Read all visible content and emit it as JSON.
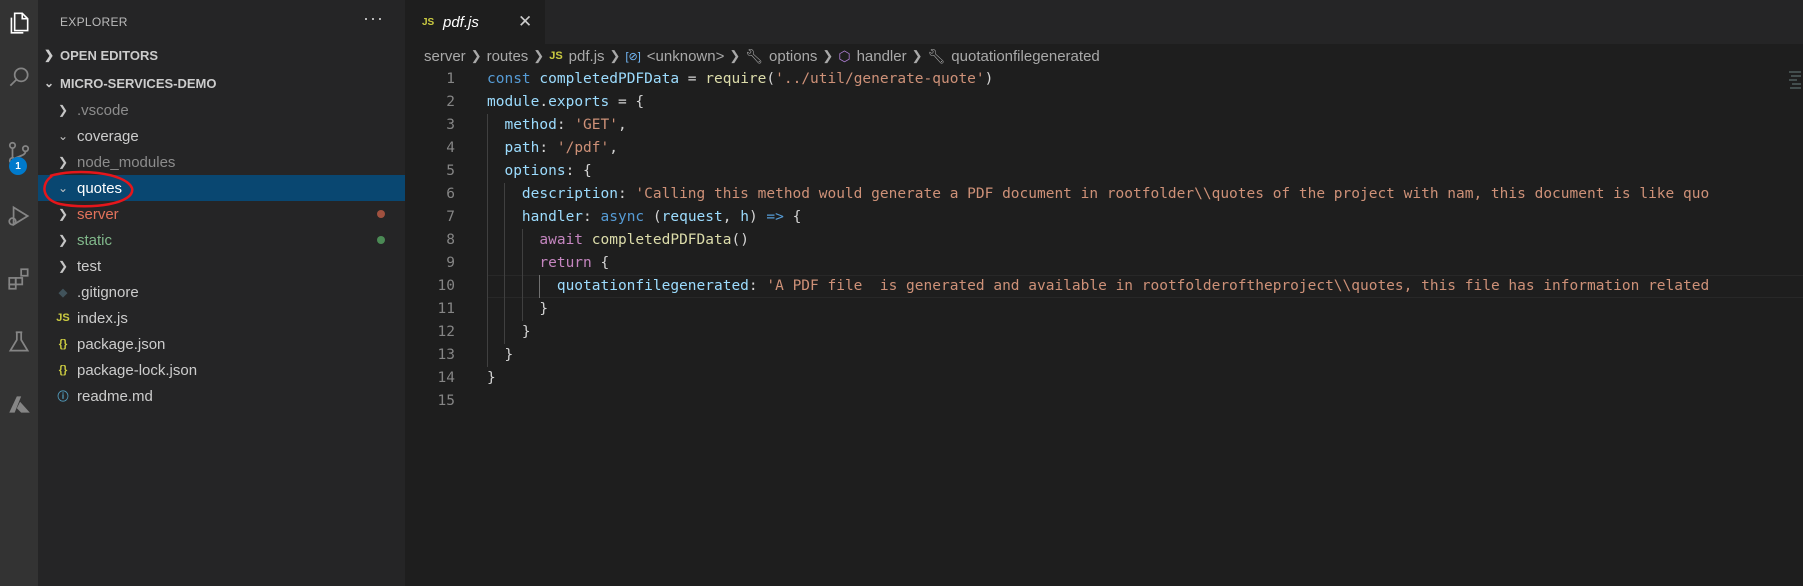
{
  "sidebar": {
    "title": "EXPLORER",
    "more": "···",
    "open_editors": "OPEN EDITORS",
    "project": "MICRO-SERVICES-DEMO",
    "items": [
      {
        "label": ".vscode",
        "kind": "folder",
        "expanded": false,
        "state": "ignored"
      },
      {
        "label": "coverage",
        "kind": "folder",
        "expanded": true,
        "state": "normal"
      },
      {
        "label": "node_modules",
        "kind": "folder",
        "expanded": false,
        "state": "ignored"
      },
      {
        "label": "quotes",
        "kind": "folder",
        "expanded": true,
        "state": "selected"
      },
      {
        "label": "server",
        "kind": "folder",
        "expanded": false,
        "state": "modified"
      },
      {
        "label": "static",
        "kind": "folder",
        "expanded": false,
        "state": "added"
      },
      {
        "label": "test",
        "kind": "folder",
        "expanded": false,
        "state": "normal"
      },
      {
        "label": ".gitignore",
        "kind": "file",
        "icon": "◆",
        "state": "normal"
      },
      {
        "label": "index.js",
        "kind": "file",
        "icon": "JS",
        "state": "normal"
      },
      {
        "label": "package.json",
        "kind": "file",
        "icon": "{}",
        "state": "normal"
      },
      {
        "label": "package-lock.json",
        "kind": "file",
        "icon": "{}",
        "state": "normal"
      },
      {
        "label": "readme.md",
        "kind": "file",
        "icon": "ⓘ",
        "state": "normal"
      }
    ]
  },
  "activity": {
    "source_control_badge": "1"
  },
  "tab": {
    "icon": "JS",
    "name": "pdf.js",
    "close": "✕"
  },
  "breadcrumb": {
    "items": [
      "server",
      "routes",
      "pdf.js",
      "<unknown>",
      "options",
      "handler",
      "quotationfilegenerated"
    ]
  },
  "editor": {
    "line_numbers": [
      "1",
      "2",
      "3",
      "4",
      "5",
      "6",
      "7",
      "8",
      "9",
      "10",
      "11",
      "12",
      "13",
      "14",
      "15"
    ],
    "lines": [
      [
        [
          "kw",
          "const"
        ],
        [
          "p",
          " "
        ],
        [
          "var",
          "completedPDFData"
        ],
        [
          "p",
          " = "
        ],
        [
          "fn",
          "require"
        ],
        [
          "p",
          "("
        ],
        [
          "str",
          "'../util/generate-quote'"
        ],
        [
          "p",
          ")"
        ]
      ],
      [
        [
          "var",
          "module"
        ],
        [
          "p",
          "."
        ],
        [
          "var",
          "exports"
        ],
        [
          "p",
          " = {"
        ]
      ],
      [
        [
          "p",
          "  "
        ],
        [
          "var",
          "method"
        ],
        [
          "p",
          ": "
        ],
        [
          "str",
          "'GET'"
        ],
        [
          "p",
          ","
        ]
      ],
      [
        [
          "p",
          "  "
        ],
        [
          "var",
          "path"
        ],
        [
          "p",
          ": "
        ],
        [
          "str",
          "'/pdf'"
        ],
        [
          "p",
          ","
        ]
      ],
      [
        [
          "p",
          "  "
        ],
        [
          "var",
          "options"
        ],
        [
          "p",
          ": {"
        ]
      ],
      [
        [
          "p",
          "    "
        ],
        [
          "var",
          "description"
        ],
        [
          "p",
          ": "
        ],
        [
          "str",
          "'Calling this method would generate a PDF document in rootfolder\\\\quotes of the project with nam, this document is like quo"
        ]
      ],
      [
        [
          "p",
          "    "
        ],
        [
          "var",
          "handler"
        ],
        [
          "p",
          ": "
        ],
        [
          "kw",
          "async"
        ],
        [
          "p",
          " ("
        ],
        [
          "var",
          "request"
        ],
        [
          "p",
          ", "
        ],
        [
          "var",
          "h"
        ],
        [
          "p",
          ") "
        ],
        [
          "kw",
          "=>"
        ],
        [
          "p",
          " {"
        ]
      ],
      [
        [
          "p",
          "      "
        ],
        [
          "ctl",
          "await"
        ],
        [
          "p",
          " "
        ],
        [
          "fn",
          "completedPDFData"
        ],
        [
          "p",
          "()"
        ]
      ],
      [
        [
          "p",
          "      "
        ],
        [
          "ctl",
          "return"
        ],
        [
          "p",
          " {"
        ]
      ],
      [
        [
          "p",
          "        "
        ],
        [
          "var",
          "quotationfilegenerated"
        ],
        [
          "p",
          ": "
        ],
        [
          "str",
          "'A PDF file  is generated and available in rootfolderoftheproject\\\\quotes, this file has information related"
        ]
      ],
      [
        [
          "p",
          "      }"
        ]
      ],
      [
        [
          "p",
          "    }"
        ]
      ],
      [
        [
          "p",
          "  }"
        ]
      ],
      [
        [
          "p",
          "}"
        ]
      ],
      [
        [
          "p",
          ""
        ]
      ]
    ]
  }
}
